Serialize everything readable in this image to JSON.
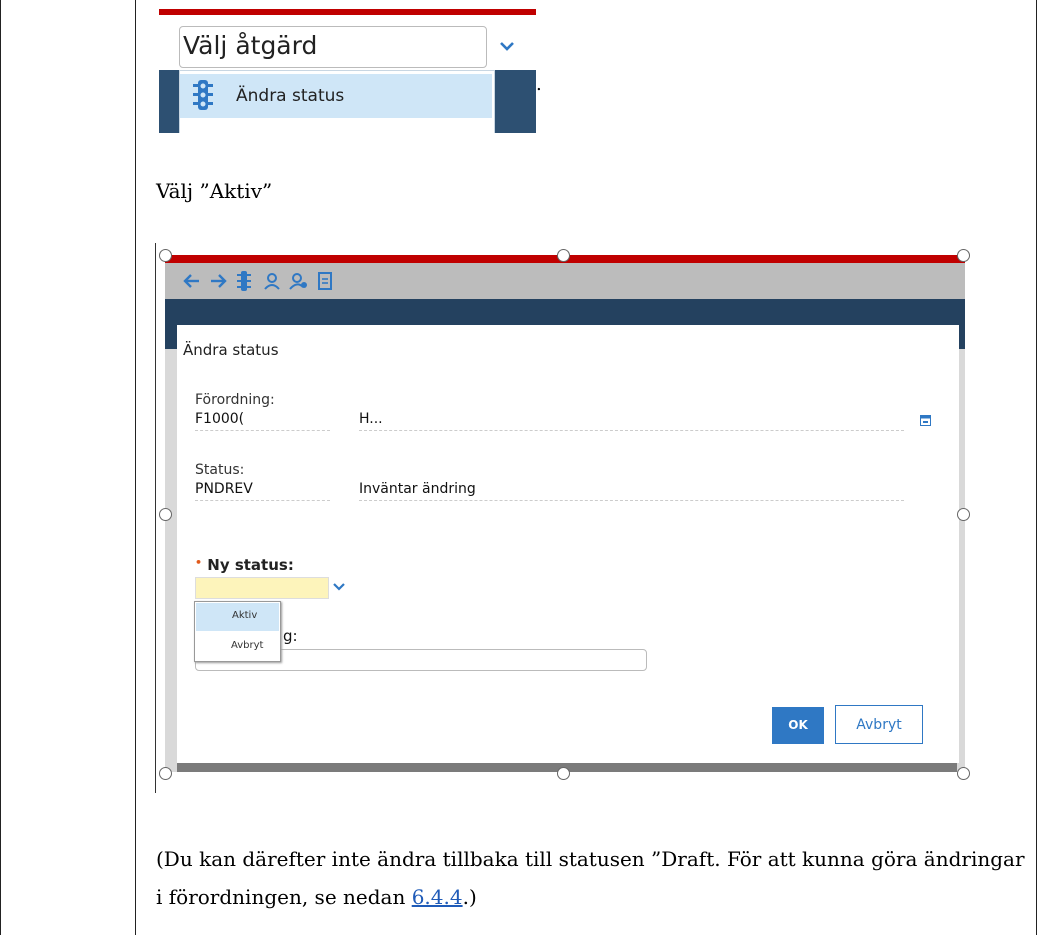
{
  "screenshot1": {
    "select_label": "Välj åtgärd",
    "option_label": "Ändra status",
    "trailing_mark": "."
  },
  "instruction": "Välj ”Aktiv”",
  "dialog": {
    "title": "Ändra status",
    "forordning_label": "Förordning:",
    "forordning_code": "F1000(",
    "forordning_desc": "H...",
    "status_label": "Status:",
    "status_code": "PNDREV",
    "status_desc": "Inväntar ändring",
    "ny_status_label": "Ny status:",
    "required_mark": "•",
    "options": [
      "Aktiv",
      "Avbryt"
    ],
    "partial_label": "g:",
    "ok_label": "OK",
    "cancel_label": "Avbryt"
  },
  "note": {
    "text_before": "(Du kan därefter inte ändra tillbaka till statusen ”Draft. För att kunna göra ändringar i förordningen, se nedan ",
    "link": "6.4.4",
    "text_after": ".)"
  },
  "colors": {
    "accent_red": "#c00000",
    "navy": "#24415f",
    "ok_blue": "#2f78c4",
    "highlight": "#cfe6f7"
  }
}
